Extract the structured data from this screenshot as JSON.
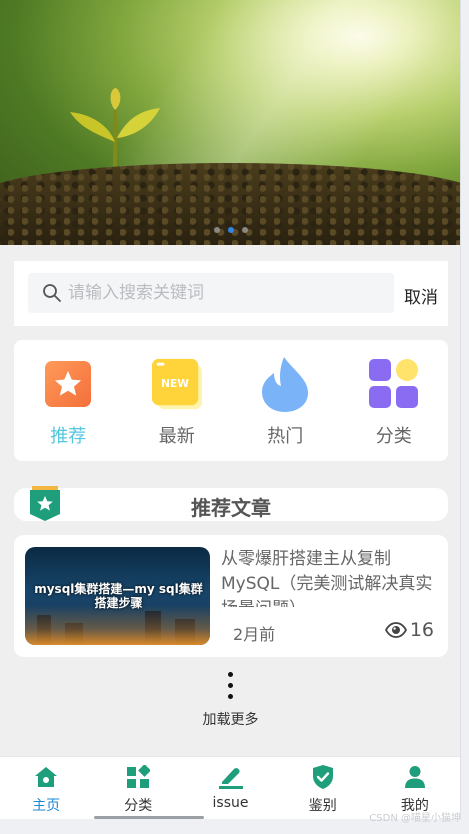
{
  "banner": {
    "active_dot": 1,
    "dot_count": 3
  },
  "search": {
    "placeholder": "请输入搜索关键词",
    "value": "",
    "cancel_label": "取消",
    "icon": "search-icon"
  },
  "categories": [
    {
      "label": "推荐",
      "icon": "star-icon",
      "active": true
    },
    {
      "label": "最新",
      "icon": "new-icon",
      "active": false
    },
    {
      "label": "热门",
      "icon": "flame-icon",
      "active": false
    },
    {
      "label": "分类",
      "icon": "grid-icon",
      "active": false
    }
  ],
  "recommend": {
    "title": "推荐文章",
    "icon": "star-badge-icon"
  },
  "articles": [
    {
      "title": "从零爆肝搭建主从复制MySQL（完美测试解决真实场景问题）",
      "thumb_text": "mysql集群搭建—my sql集群搭建步骤",
      "time": "2月前",
      "views": "16"
    }
  ],
  "load_more": {
    "label": "加载更多"
  },
  "tabbar": [
    {
      "label": "主页",
      "icon": "home-icon",
      "active": true
    },
    {
      "label": "分类",
      "icon": "category-icon",
      "active": false
    },
    {
      "label": "issue",
      "icon": "edit-icon",
      "active": false
    },
    {
      "label": "鉴别",
      "icon": "shield-check-icon",
      "active": false
    },
    {
      "label": "我的",
      "icon": "user-icon",
      "active": false
    }
  ],
  "watermark": "CSDN @喵星小猫坤",
  "colors": {
    "accent": "#1e88d6",
    "active_category": "#53c7e0",
    "tab_icon": "#1e9e7a"
  }
}
